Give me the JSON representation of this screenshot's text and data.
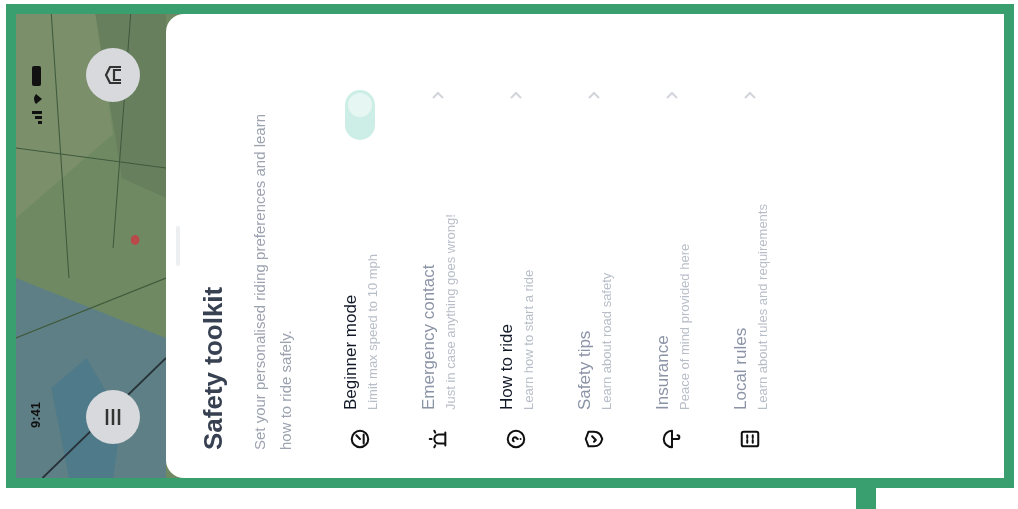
{
  "status_bar": {
    "time": "9:41"
  },
  "sheet": {
    "title": "Safety toolkit",
    "description": "Set your personalised riding preferences and learn how to ride safely.",
    "items": [
      {
        "kind": "toggle",
        "title": "Beginner mode",
        "subtitle": "Limit max speed to 10 mph",
        "dimmed": false,
        "on": true
      },
      {
        "kind": "link",
        "title": "Emergency contact",
        "subtitle": "Just in case anything goes wrong!",
        "dimmed": true
      },
      {
        "kind": "link",
        "title": "How to ride",
        "subtitle": "Learn how to start a ride",
        "dimmed": false
      },
      {
        "kind": "link",
        "title": "Safety tips",
        "subtitle": "Learn about road safety",
        "dimmed": true
      },
      {
        "kind": "link",
        "title": "Insurance",
        "subtitle": "Peace of mind provided here",
        "dimmed": true
      },
      {
        "kind": "link",
        "title": "Local rules",
        "subtitle": "Learn about rules and requirements",
        "dimmed": true
      }
    ]
  }
}
